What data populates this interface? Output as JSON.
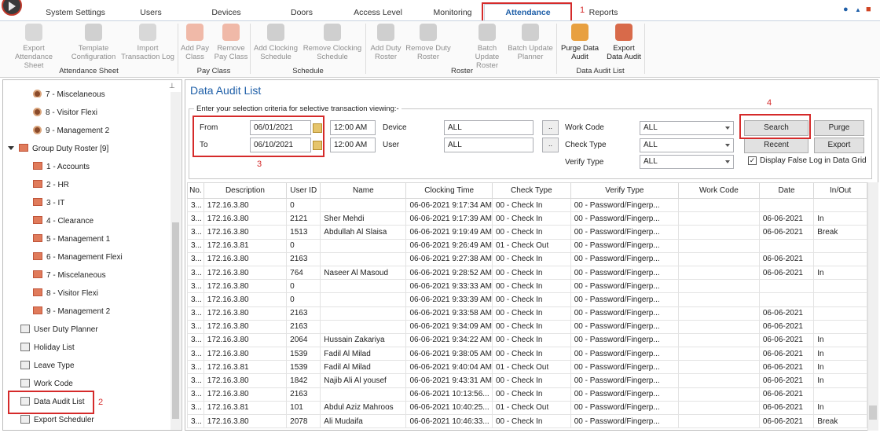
{
  "tabs": [
    "System Settings",
    "Users",
    "Devices",
    "Doors",
    "Access Level",
    "Monitoring",
    "Attendance",
    "Reports"
  ],
  "active_tab": "Attendance",
  "annotations": {
    "n1": "1",
    "n2": "2",
    "n3": "3",
    "n4": "4"
  },
  "ribbon": {
    "buttons": [
      {
        "label1": "Export",
        "label2": "Attendance Sheet",
        "enabled": false
      },
      {
        "label1": "Template",
        "label2": "Configuration",
        "enabled": false
      },
      {
        "label1": "Import",
        "label2": "Transaction Log",
        "enabled": false
      },
      {
        "label1": "Add Pay",
        "label2": "Class",
        "enabled": false
      },
      {
        "label1": "Remove",
        "label2": "Pay Class",
        "enabled": false
      },
      {
        "label1": "Add Clocking",
        "label2": "Schedule",
        "enabled": false
      },
      {
        "label1": "Remove Clocking",
        "label2": "Schedule",
        "enabled": false
      },
      {
        "label1": "Add Duty",
        "label2": "Roster",
        "enabled": false
      },
      {
        "label1": "Remove Duty",
        "label2": "Roster",
        "enabled": false
      },
      {
        "label1": "Batch Update",
        "label2": "Roster",
        "enabled": false
      },
      {
        "label1": "Batch Update",
        "label2": "Planner",
        "enabled": false
      },
      {
        "label1": "Purge Data",
        "label2": "Audit",
        "enabled": true
      },
      {
        "label1": "Export",
        "label2": "Data Audit",
        "enabled": true
      }
    ],
    "groups": [
      "Attendance Sheet",
      "Pay Class",
      "Schedule",
      "Roster",
      "Data Audit List"
    ]
  },
  "tree": {
    "items": [
      {
        "label": "8 - Visitor Flexi",
        "type": "clock"
      },
      {
        "label": "9 - Management 2",
        "type": "clock"
      },
      {
        "label": "Group Duty Roster [9]",
        "type": "group"
      },
      {
        "label": "1 - Accounts",
        "type": "roster"
      },
      {
        "label": "2 - HR",
        "type": "roster"
      },
      {
        "label": "3 - IT",
        "type": "roster"
      },
      {
        "label": "4 - Clearance",
        "type": "roster"
      },
      {
        "label": "5 - Management 1",
        "type": "roster"
      },
      {
        "label": "6 - Management Flexi",
        "type": "roster"
      },
      {
        "label": "7 - Miscelaneous",
        "type": "roster"
      },
      {
        "label": "8 - Visitor Flexi",
        "type": "roster"
      },
      {
        "label": "9 - Management 2",
        "type": "roster"
      },
      {
        "label": "User Duty Planner",
        "type": "gen"
      },
      {
        "label": "Holiday List",
        "type": "gen"
      },
      {
        "label": "Leave Type",
        "type": "gen"
      },
      {
        "label": "Work Code",
        "type": "gen"
      },
      {
        "label": "Data Audit List",
        "type": "gen"
      },
      {
        "label": "Export Scheduler",
        "type": "gen"
      }
    ],
    "partial_top": "7 - Miscelaneous"
  },
  "page_title": "Data Audit List",
  "criteria": {
    "legend": "Enter your selection criteria for selective transaction viewing:-",
    "from_label": "From",
    "from_date": "06/01/2021",
    "from_time": "12:00 AM",
    "to_label": "To",
    "to_date": "06/10/2021",
    "to_time": "12:00 AM",
    "device_label": "Device",
    "device_value": "ALL",
    "user_label": "User",
    "user_value": "ALL",
    "dots": "..",
    "work_code_label": "Work Code",
    "work_code_value": "ALL",
    "check_type_label": "Check Type",
    "check_type_value": "ALL",
    "verify_type_label": "Verify Type",
    "verify_type_value": "ALL",
    "search": "Search",
    "purge": "Purge",
    "recent": "Recent",
    "export": "Export",
    "false_log_label": "Display False Log in Data Grid",
    "false_log_checked": true
  },
  "grid": {
    "columns": [
      "No.",
      "Description",
      "User ID",
      "Name",
      "Clocking Time",
      "Check Type",
      "Verify Type",
      "Work Code",
      "Date",
      "In/Out"
    ],
    "rows": [
      [
        "3...",
        "172.16.3.80",
        "0",
        "",
        "06-06-2021 9:17:34 AM",
        "00 - Check In",
        "00 - Password/Fingerp...",
        "",
        "",
        ""
      ],
      [
        "3...",
        "172.16.3.80",
        "2121",
        "Sher Mehdi",
        "06-06-2021 9:17:39 AM",
        "00 - Check In",
        "00 - Password/Fingerp...",
        "",
        "06-06-2021",
        "In"
      ],
      [
        "3...",
        "172.16.3.80",
        "1513",
        "Abdullah Al Slaisa",
        "06-06-2021 9:19:49 AM",
        "00 - Check In",
        "00 - Password/Fingerp...",
        "",
        "06-06-2021",
        "Break"
      ],
      [
        "3...",
        "172.16.3.81",
        "0",
        "",
        "06-06-2021 9:26:49 AM",
        "01 - Check Out",
        "00 - Password/Fingerp...",
        "",
        "",
        ""
      ],
      [
        "3...",
        "172.16.3.80",
        "2163",
        "",
        "06-06-2021 9:27:38 AM",
        "00 - Check In",
        "00 - Password/Fingerp...",
        "",
        "06-06-2021",
        ""
      ],
      [
        "3...",
        "172.16.3.80",
        "764",
        "Naseer Al Masoud",
        "06-06-2021 9:28:52 AM",
        "00 - Check In",
        "00 - Password/Fingerp...",
        "",
        "06-06-2021",
        "In"
      ],
      [
        "3...",
        "172.16.3.80",
        "0",
        "",
        "06-06-2021 9:33:33 AM",
        "00 - Check In",
        "00 - Password/Fingerp...",
        "",
        "",
        ""
      ],
      [
        "3...",
        "172.16.3.80",
        "0",
        "",
        "06-06-2021 9:33:39 AM",
        "00 - Check In",
        "00 - Password/Fingerp...",
        "",
        "",
        ""
      ],
      [
        "3...",
        "172.16.3.80",
        "2163",
        "",
        "06-06-2021 9:33:58 AM",
        "00 - Check In",
        "00 - Password/Fingerp...",
        "",
        "06-06-2021",
        ""
      ],
      [
        "3...",
        "172.16.3.80",
        "2163",
        "",
        "06-06-2021 9:34:09 AM",
        "00 - Check In",
        "00 - Password/Fingerp...",
        "",
        "06-06-2021",
        ""
      ],
      [
        "3...",
        "172.16.3.80",
        "2064",
        "Hussain Zakariya",
        "06-06-2021 9:34:22 AM",
        "00 - Check In",
        "00 - Password/Fingerp...",
        "",
        "06-06-2021",
        "In"
      ],
      [
        "3...",
        "172.16.3.80",
        "1539",
        "Fadil Al Milad",
        "06-06-2021 9:38:05 AM",
        "00 - Check In",
        "00 - Password/Fingerp...",
        "",
        "06-06-2021",
        "In"
      ],
      [
        "3...",
        "172.16.3.81",
        "1539",
        "Fadil Al Milad",
        "06-06-2021 9:40:04 AM",
        "01 - Check Out",
        "00 - Password/Fingerp...",
        "",
        "06-06-2021",
        "In"
      ],
      [
        "3...",
        "172.16.3.80",
        "1842",
        "Najib Ali Al yousef",
        "06-06-2021 9:43:31 AM",
        "00 - Check In",
        "00 - Password/Fingerp...",
        "",
        "06-06-2021",
        "In"
      ],
      [
        "3...",
        "172.16.3.80",
        "2163",
        "",
        "06-06-2021 10:13:56...",
        "00 - Check In",
        "00 - Password/Fingerp...",
        "",
        "06-06-2021",
        ""
      ],
      [
        "3...",
        "172.16.3.81",
        "101",
        "Abdul Aziz Mahroos",
        "06-06-2021 10:40:25...",
        "01 - Check Out",
        "00 - Password/Fingerp...",
        "",
        "06-06-2021",
        "In"
      ],
      [
        "3...",
        "172.16.3.80",
        "2078",
        "Ali Mudaifa",
        "06-06-2021 10:46:33...",
        "00 - Check In",
        "00 - Password/Fingerp...",
        "",
        "06-06-2021",
        "Break"
      ]
    ]
  }
}
